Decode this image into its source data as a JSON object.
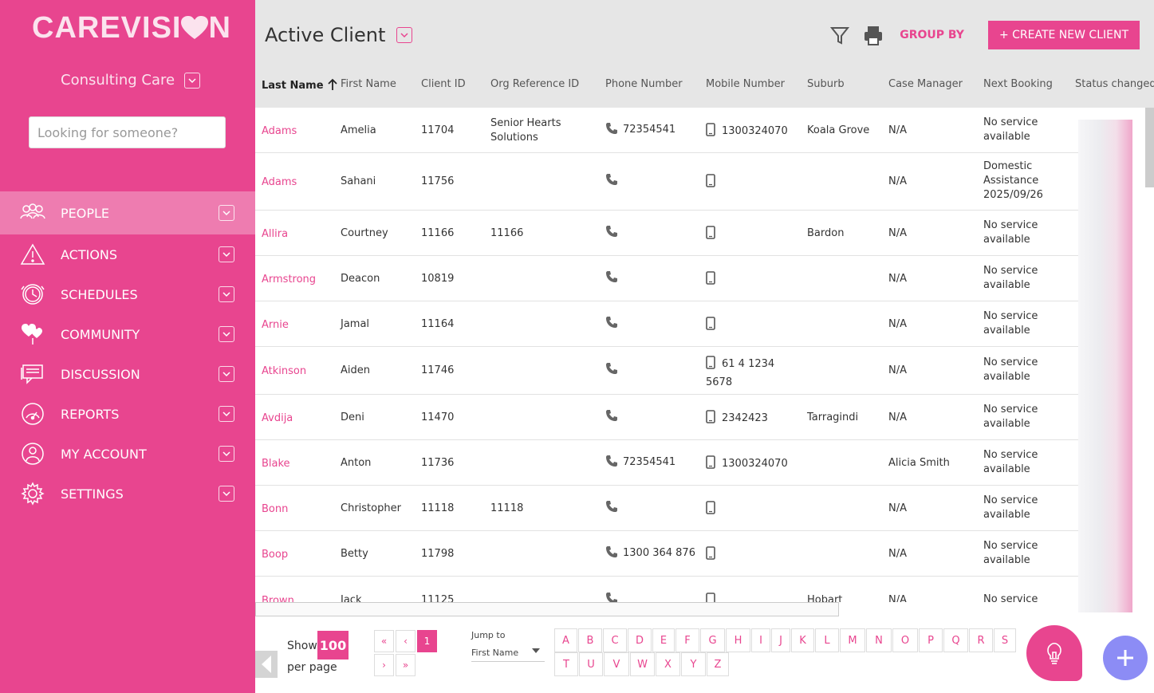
{
  "brand": {
    "logo_text_a": "CAREVISI",
    "logo_text_b": "N",
    "accent": "#e8458f",
    "secondary": "#8c8cf5"
  },
  "sidebar": {
    "org_name": "Consulting Care",
    "search_placeholder": "Looking for someone?",
    "items": [
      {
        "label": "PEOPLE",
        "icon": "people-icon",
        "active": true
      },
      {
        "label": "ACTIONS",
        "icon": "warning-icon"
      },
      {
        "label": "SCHEDULES",
        "icon": "clock-icon"
      },
      {
        "label": "COMMUNITY",
        "icon": "hearts-icon"
      },
      {
        "label": "DISCUSSION",
        "icon": "chat-icon"
      },
      {
        "label": "REPORTS",
        "icon": "gauge-icon"
      },
      {
        "label": "MY ACCOUNT",
        "icon": "user-icon"
      },
      {
        "label": "SETTINGS",
        "icon": "gear-icon"
      }
    ]
  },
  "header": {
    "title": "Active Client",
    "group_by": "GROUP BY",
    "create_label": "+ CREATE NEW CLIENT"
  },
  "table": {
    "columns": [
      "Last Name",
      "First Name",
      "Client ID",
      "Org Reference ID",
      "Phone Number",
      "Mobile Number",
      "Suburb",
      "Case Manager",
      "Next Booking",
      "Status changed by"
    ],
    "rows": [
      {
        "last": "Adams",
        "first": "Amelia",
        "id": "11704",
        "org_ref_1": "Senior Hearts",
        "org_ref_2": "Solutions",
        "phone": "72354541",
        "mobile_1": "1300324070",
        "mobile_2": "",
        "suburb": "Koala Grove",
        "manager": "N/A",
        "booking_1": "No service",
        "booking_2": "available",
        "booking_3": ""
      },
      {
        "last": "Adams",
        "first": "Sahani",
        "id": "11756",
        "org_ref_1": "",
        "org_ref_2": "",
        "phone": "",
        "mobile_1": "",
        "mobile_2": "",
        "suburb": "",
        "manager": "N/A",
        "booking_1": "Domestic",
        "booking_2": "Assistance",
        "booking_3": "2025/09/26"
      },
      {
        "last": "Allira",
        "first": "Courtney",
        "id": "11166",
        "org_ref_1": "11166",
        "org_ref_2": "",
        "phone": "",
        "mobile_1": "",
        "mobile_2": "",
        "suburb": "Bardon",
        "manager": "N/A",
        "booking_1": "No service",
        "booking_2": "available",
        "booking_3": ""
      },
      {
        "last": "Armstrong",
        "first": "Deacon",
        "id": "10819",
        "org_ref_1": "",
        "org_ref_2": "",
        "phone": "",
        "mobile_1": "",
        "mobile_2": "",
        "suburb": "",
        "manager": "N/A",
        "booking_1": "No service",
        "booking_2": "available",
        "booking_3": ""
      },
      {
        "last": "Arnie",
        "first": "Jamal",
        "id": "11164",
        "org_ref_1": "",
        "org_ref_2": "",
        "phone": "",
        "mobile_1": "",
        "mobile_2": "",
        "suburb": "",
        "manager": "N/A",
        "booking_1": "No service",
        "booking_2": "available",
        "booking_3": ""
      },
      {
        "last": "Atkinson",
        "first": "Aiden",
        "id": "11746",
        "org_ref_1": "",
        "org_ref_2": "",
        "phone": "",
        "mobile_1": "61 4 1234",
        "mobile_2": "5678",
        "suburb": "",
        "manager": "N/A",
        "booking_1": "No service",
        "booking_2": "available",
        "booking_3": ""
      },
      {
        "last": "Avdija",
        "first": "Deni",
        "id": "11470",
        "org_ref_1": "",
        "org_ref_2": "",
        "phone": "",
        "mobile_1": "2342423",
        "mobile_2": "",
        "suburb": "Tarragindi",
        "manager": "N/A",
        "booking_1": "No service",
        "booking_2": "available",
        "booking_3": ""
      },
      {
        "last": "Blake",
        "first": "Anton",
        "id": "11736",
        "org_ref_1": "",
        "org_ref_2": "",
        "phone": "72354541",
        "mobile_1": "1300324070",
        "mobile_2": "",
        "suburb": "",
        "manager": "Alicia Smith",
        "booking_1": "No service",
        "booking_2": "available",
        "booking_3": ""
      },
      {
        "last": "Bonn",
        "first": "Christopher",
        "id": "11118",
        "org_ref_1": "11118",
        "org_ref_2": "",
        "phone": "",
        "mobile_1": "",
        "mobile_2": "",
        "suburb": "",
        "manager": "N/A",
        "booking_1": "No service",
        "booking_2": "available",
        "booking_3": ""
      },
      {
        "last": "Boop",
        "first": "Betty",
        "id": "11798",
        "org_ref_1": "",
        "org_ref_2": "",
        "phone": "1300 364 876",
        "mobile_1": "",
        "mobile_2": "",
        "suburb": "",
        "manager": "N/A",
        "booking_1": "No service",
        "booking_2": "available",
        "booking_3": ""
      },
      {
        "last": "Brown",
        "first": "Jack",
        "id": "11125",
        "org_ref_1": "",
        "org_ref_2": "",
        "phone": "",
        "mobile_1": "",
        "mobile_2": "",
        "suburb": "Hobart",
        "manager": "N/A",
        "booking_1": "No service",
        "booking_2": "",
        "booking_3": ""
      }
    ]
  },
  "pagination": {
    "show_label": "Show",
    "per_page_label": "per page",
    "page_size": "100",
    "first": "«",
    "prev": "‹",
    "current": "1",
    "next": "›",
    "last": "»",
    "jump_label": "Jump to",
    "jump_value": "First Name",
    "letters": [
      "A",
      "B",
      "C",
      "D",
      "E",
      "F",
      "G",
      "H",
      "I",
      "J",
      "K",
      "L",
      "M",
      "N",
      "O",
      "P",
      "Q",
      "R",
      "S",
      "T",
      "U",
      "V",
      "W",
      "X",
      "Y",
      "Z"
    ]
  }
}
